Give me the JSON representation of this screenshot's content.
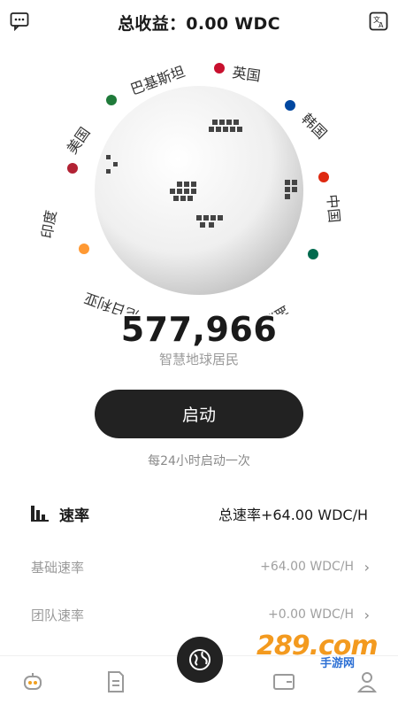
{
  "header": {
    "title": "总收益：0.00 WDC",
    "left_icon": "chat-bubble-icon",
    "right_icon": "translate-icon"
  },
  "globe": {
    "countries": [
      {
        "label": "巴基斯坦",
        "flag": "pakistan-flag-icon",
        "color": "#1f7a3a"
      },
      {
        "label": "英国",
        "flag": "uk-flag-icon",
        "color": "#c8102e"
      },
      {
        "label": "韩国",
        "flag": "korea-flag-icon",
        "color": "#0047a0"
      },
      {
        "label": "中国",
        "flag": "china-flag-icon",
        "color": "#de2910"
      },
      {
        "label": "孟加拉国",
        "flag": "bangladesh-flag-icon",
        "color": "#006a4e"
      },
      {
        "label": "尼日利亚",
        "flag": "",
        "color": "#008751"
      },
      {
        "label": "印度",
        "flag": "india-flag-icon",
        "color": "#ff9933"
      },
      {
        "label": "美国",
        "flag": "usa-flag-icon",
        "color": "#b22234"
      }
    ]
  },
  "stats": {
    "population": "577,966",
    "population_label": "智慧地球居民"
  },
  "action": {
    "start_label": "启动",
    "note": "每24小时启动一次"
  },
  "rates": {
    "title": "速率",
    "total": "总速率+64.00 WDC/H",
    "items": [
      {
        "label": "基础速率",
        "value": "+64.00 WDC/H"
      },
      {
        "label": "团队速率",
        "value": "+0.00 WDC/H"
      }
    ]
  },
  "nav": {
    "items": [
      "robot-icon",
      "document-icon",
      "globe-icon",
      "wallet-icon",
      "user-icon"
    ]
  },
  "watermark": {
    "brand": "289.com",
    "sub": "手游网"
  }
}
